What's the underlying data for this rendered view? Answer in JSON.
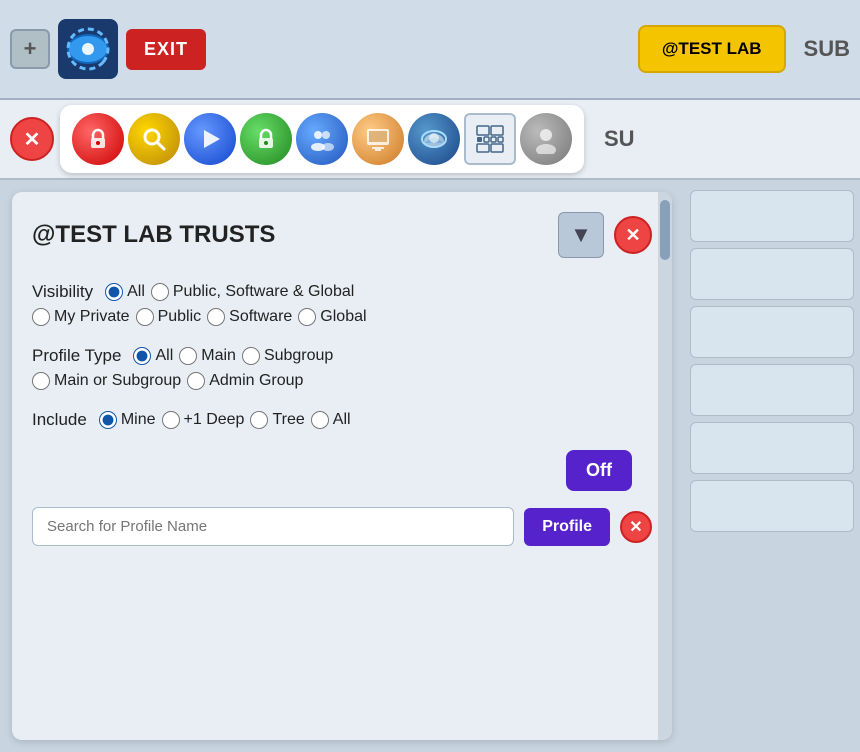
{
  "toolbar": {
    "add_label": "+",
    "exit_label": "EXIT",
    "test_lab_label": "@TEST LAB",
    "sub_label": "SUB"
  },
  "icon_toolbar": {
    "close_label": "✕",
    "right_sub_label": "SU",
    "icons": [
      {
        "name": "lock-icon",
        "label": "🔒"
      },
      {
        "name": "search-icon",
        "label": "🔍"
      },
      {
        "name": "play-icon",
        "label": "▶"
      },
      {
        "name": "green-icon",
        "label": "🔒"
      },
      {
        "name": "group-icon",
        "label": "👥"
      },
      {
        "name": "monitor-icon",
        "label": "🖥"
      },
      {
        "name": "cloud-icon",
        "label": "☁"
      }
    ]
  },
  "panel": {
    "title": "@TEST LAB TRUSTS",
    "sort_icon": "▼",
    "close_icon": "✕",
    "visibility": {
      "label": "Visibility",
      "options": [
        {
          "id": "vis-all",
          "value": "all",
          "label": "All",
          "checked": true
        },
        {
          "id": "vis-public-sw-global",
          "value": "public-sw-global",
          "label": "Public, Software & Global",
          "checked": false
        },
        {
          "id": "vis-my-private",
          "value": "my-private",
          "label": "My Private",
          "checked": false
        },
        {
          "id": "vis-public",
          "value": "public",
          "label": "Public",
          "checked": false
        },
        {
          "id": "vis-software",
          "value": "software",
          "label": "Software",
          "checked": false
        },
        {
          "id": "vis-global",
          "value": "global",
          "label": "Global",
          "checked": false
        }
      ]
    },
    "profile_type": {
      "label": "Profile Type",
      "options": [
        {
          "id": "pt-all",
          "value": "all",
          "label": "All",
          "checked": true
        },
        {
          "id": "pt-main",
          "value": "main",
          "label": "Main",
          "checked": false
        },
        {
          "id": "pt-subgroup",
          "value": "subgroup",
          "label": "Subgroup",
          "checked": false
        },
        {
          "id": "pt-main-or-sub",
          "value": "main-or-sub",
          "label": "Main or Subgroup",
          "checked": false
        },
        {
          "id": "pt-admin-group",
          "value": "admin-group",
          "label": "Admin Group",
          "checked": false
        }
      ]
    },
    "include": {
      "label": "Include",
      "options": [
        {
          "id": "inc-mine",
          "value": "mine",
          "label": "Mine",
          "checked": true
        },
        {
          "id": "inc-plus1",
          "value": "plus1",
          "label": "+1 Deep",
          "checked": false
        },
        {
          "id": "inc-tree",
          "value": "tree",
          "label": "Tree",
          "checked": false
        },
        {
          "id": "inc-all",
          "value": "all",
          "label": "All",
          "checked": false
        }
      ]
    },
    "off_button_label": "Off",
    "search_placeholder": "Search for Profile Name",
    "profile_button_label": "Profile",
    "search_close_icon": "✕"
  },
  "right_list": {
    "items": [
      "",
      "",
      "",
      "",
      "",
      ""
    ]
  }
}
